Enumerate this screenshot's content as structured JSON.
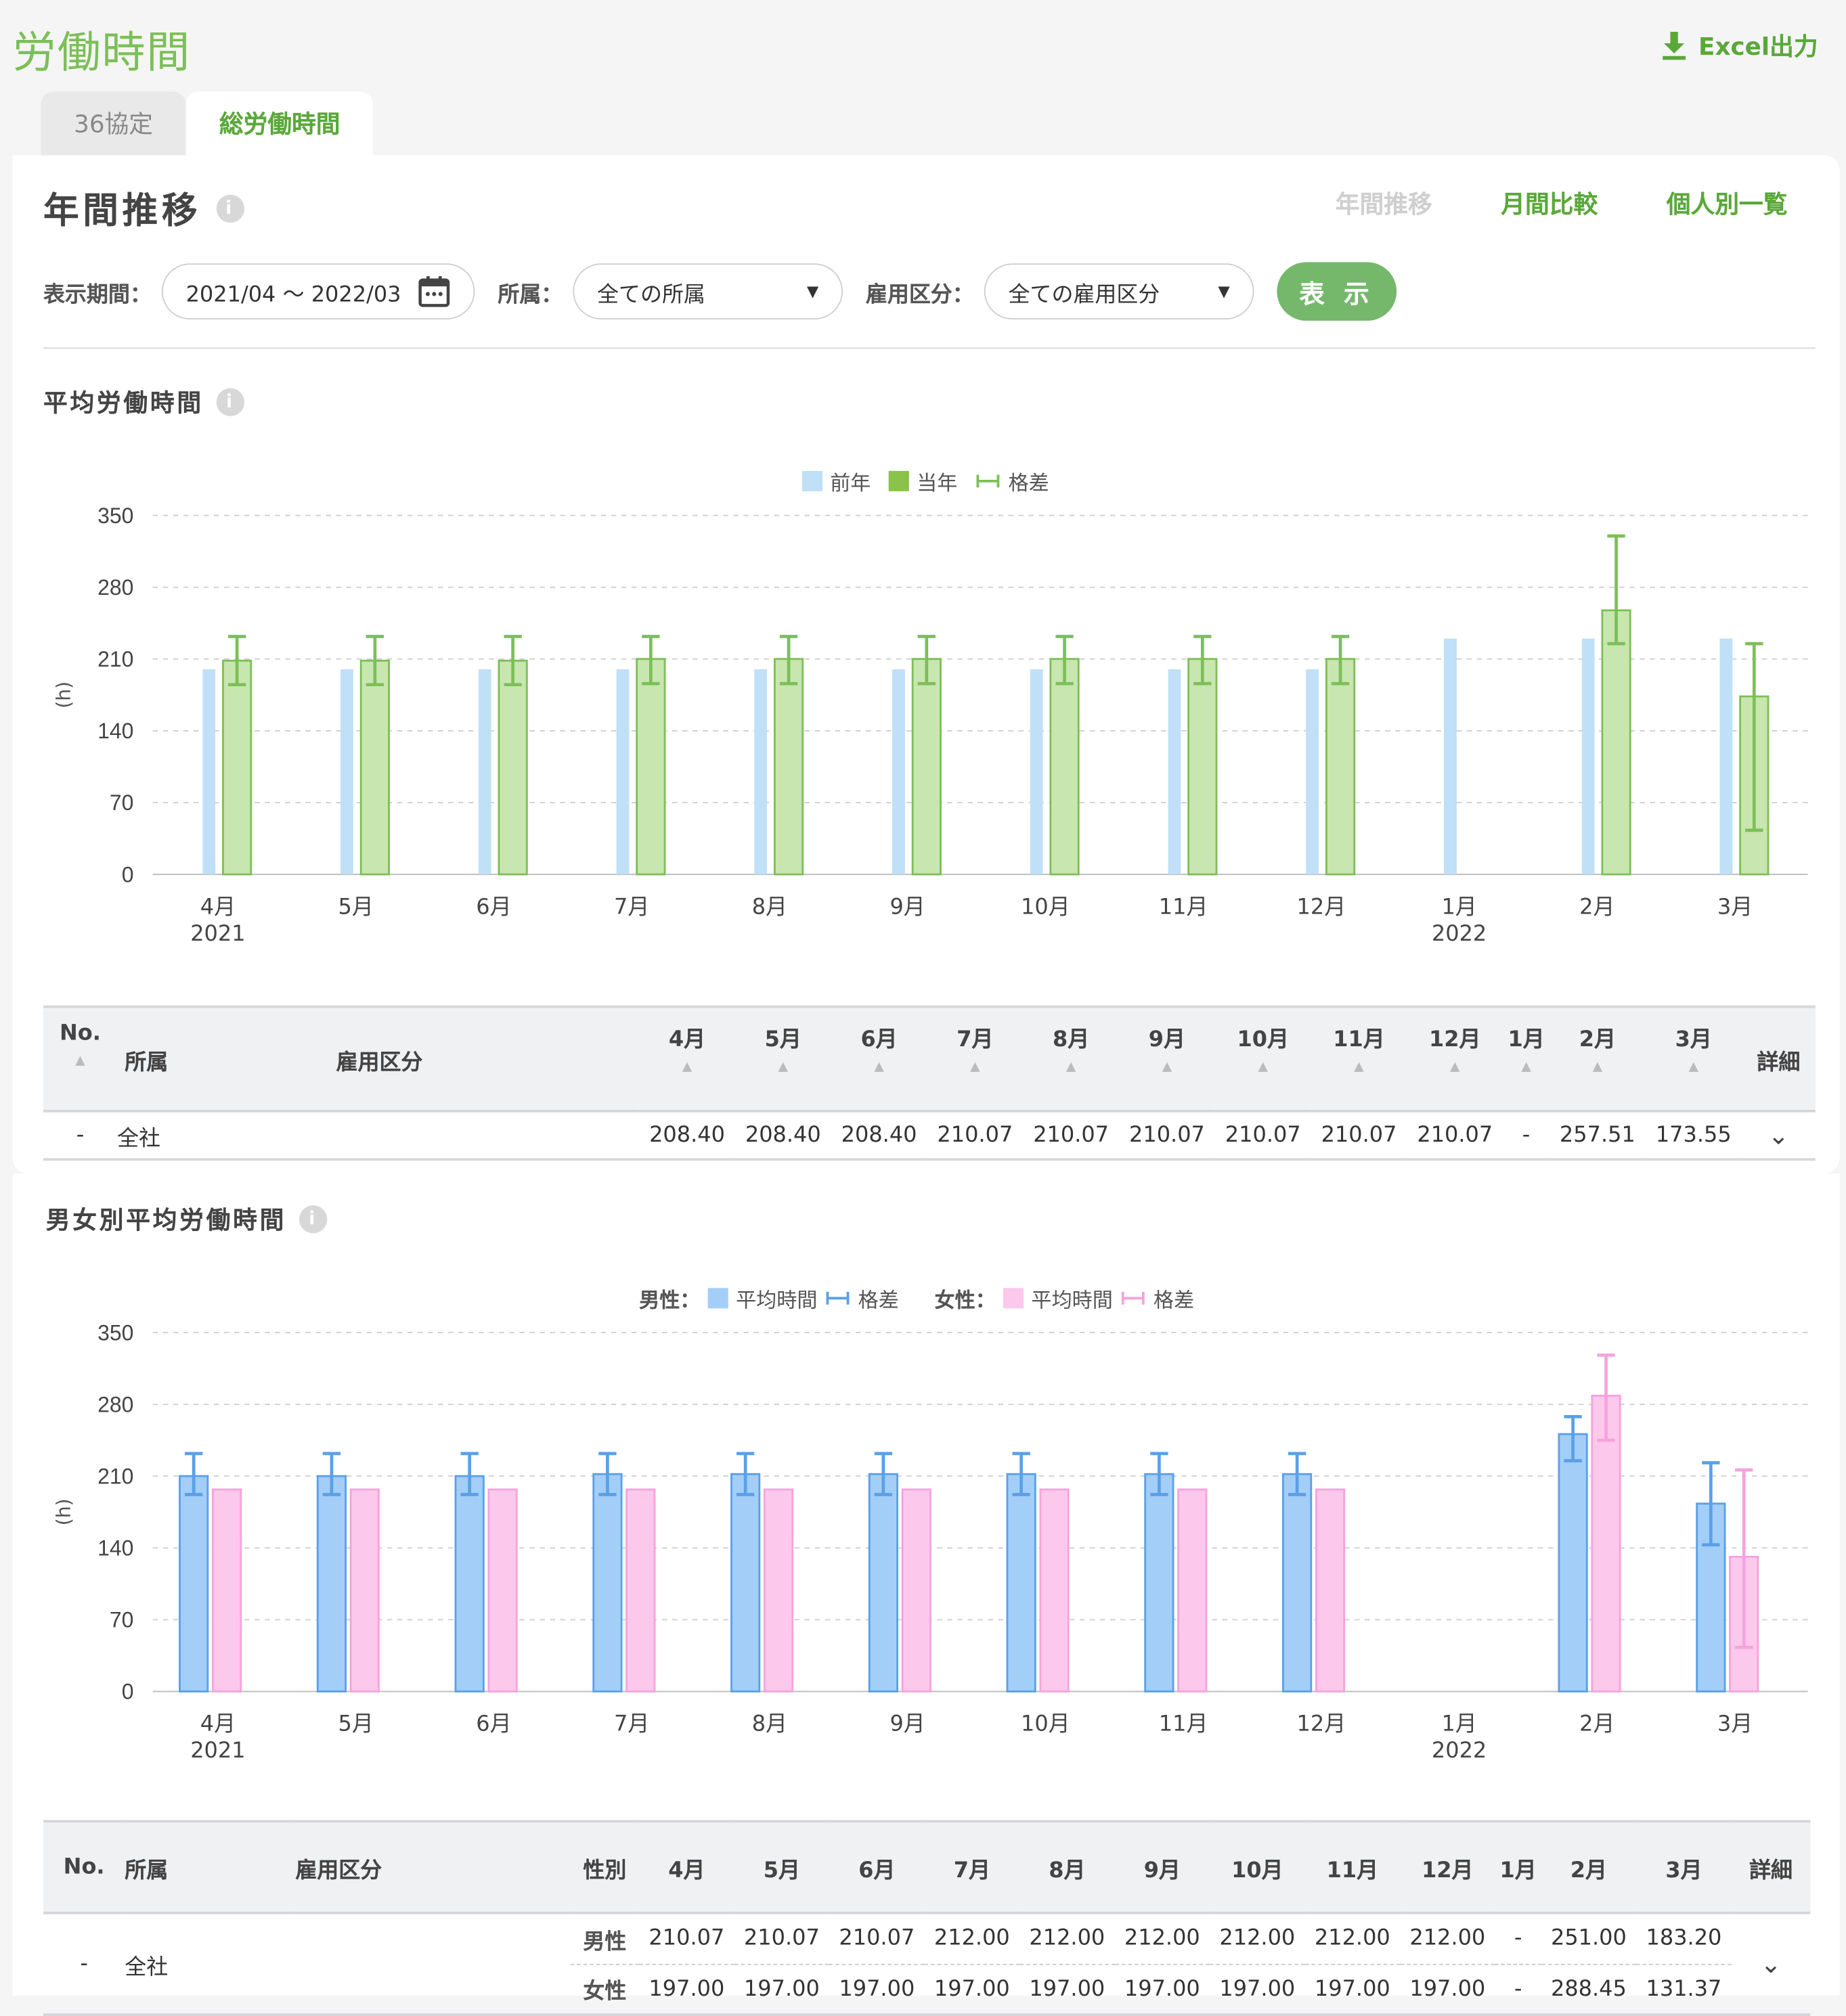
{
  "header": {
    "title": "労働時間",
    "excel_label": "Excel出力"
  },
  "tabs": [
    {
      "label": "36協定"
    },
    {
      "label": "総労働時間"
    }
  ],
  "section": {
    "title": "年間推移",
    "views": [
      "年間推移",
      "月間比較",
      "個人別一覧"
    ]
  },
  "filters": {
    "period_label": "表示期間：",
    "period_value": "2021/04 ～ 2022/03",
    "dept_label": "所属：",
    "dept_value": "全ての所属",
    "emp_label": "雇用区分：",
    "emp_value": "全ての雇用区分",
    "show_label": "表 示"
  },
  "chart1_title": "平均労働時間",
  "chart2_title": "男女別平均労働時間",
  "chart_data": [
    {
      "type": "bar",
      "title": "平均労働時間",
      "ylabel": "(h)",
      "ylim": [
        0,
        350
      ],
      "yticks": [
        0,
        70,
        140,
        210,
        280,
        350
      ],
      "categories": [
        "4月",
        "5月",
        "6月",
        "7月",
        "8月",
        "9月",
        "10月",
        "11月",
        "12月",
        "1月",
        "2月",
        "3月"
      ],
      "year_labels": {
        "0": "2021",
        "9": "2022"
      },
      "legend": [
        "前年",
        "当年",
        "格差"
      ],
      "series": [
        {
          "name": "前年",
          "values": [
            200,
            200,
            200,
            200,
            200,
            200,
            200,
            200,
            200,
            230,
            230,
            230
          ]
        },
        {
          "name": "当年",
          "values": [
            208.4,
            208.4,
            208.4,
            210.07,
            210.07,
            210.07,
            210.07,
            210.07,
            210.07,
            null,
            257.51,
            173.55
          ]
        }
      ],
      "error_bars": [
        {
          "low": 185,
          "high": 232
        },
        {
          "low": 185,
          "high": 232
        },
        {
          "low": 185,
          "high": 232
        },
        {
          "low": 186,
          "high": 232
        },
        {
          "low": 186,
          "high": 232
        },
        {
          "low": 186,
          "high": 232
        },
        {
          "low": 186,
          "high": 232
        },
        {
          "low": 186,
          "high": 232
        },
        {
          "low": 186,
          "high": 232
        },
        null,
        {
          "low": 225,
          "high": 330
        },
        {
          "low": 43,
          "high": 225
        }
      ],
      "colors": {
        "prev": "#bfe0f6",
        "curr": "#c8e6b0",
        "curr_border": "#7cbf57",
        "err": "#7cbf57"
      }
    },
    {
      "type": "bar",
      "title": "男女別平均労働時間",
      "ylabel": "(h)",
      "ylim": [
        0,
        350
      ],
      "yticks": [
        0,
        70,
        140,
        210,
        280,
        350
      ],
      "categories": [
        "4月",
        "5月",
        "6月",
        "7月",
        "8月",
        "9月",
        "10月",
        "11月",
        "12月",
        "1月",
        "2月",
        "3月"
      ],
      "year_labels": {
        "0": "2021",
        "9": "2022"
      },
      "legend": {
        "male_prefix": "男性：",
        "female_prefix": "女性：",
        "avg": "平均時間",
        "gap": "格差"
      },
      "series": [
        {
          "name": "男性",
          "values": [
            210.07,
            210.07,
            210.07,
            212.0,
            212.0,
            212.0,
            212.0,
            212.0,
            212.0,
            null,
            251.0,
            183.2
          ]
        },
        {
          "name": "女性",
          "values": [
            197.0,
            197.0,
            197.0,
            197.0,
            197.0,
            197.0,
            197.0,
            197.0,
            197.0,
            null,
            288.45,
            131.37
          ]
        }
      ],
      "male_err": [
        {
          "low": 192,
          "high": 232
        },
        {
          "low": 192,
          "high": 232
        },
        {
          "low": 192,
          "high": 232
        },
        {
          "low": 192,
          "high": 232
        },
        {
          "low": 192,
          "high": 232
        },
        {
          "low": 192,
          "high": 232
        },
        {
          "low": 192,
          "high": 232
        },
        {
          "low": 192,
          "high": 232
        },
        {
          "low": 192,
          "high": 232
        },
        null,
        {
          "low": 225,
          "high": 268
        },
        {
          "low": 143,
          "high": 223
        }
      ],
      "female_err": [
        null,
        null,
        null,
        null,
        null,
        null,
        null,
        null,
        null,
        null,
        {
          "low": 245,
          "high": 328
        },
        {
          "low": 43,
          "high": 216
        }
      ],
      "colors": {
        "male": "#a3cef7",
        "male_border": "#5aa0e8",
        "female": "#fcc8ec",
        "female_border": "#f5a3dc"
      }
    }
  ],
  "table1": {
    "headers": {
      "no": "No.",
      "dept": "所属",
      "emp": "雇用区分",
      "detail": "詳細"
    },
    "months": [
      "4月",
      "5月",
      "6月",
      "7月",
      "8月",
      "9月",
      "10月",
      "11月",
      "12月",
      "1月",
      "2月",
      "3月"
    ],
    "row": {
      "no": "-",
      "dept": "全社",
      "values": [
        "208.40",
        "208.40",
        "208.40",
        "210.07",
        "210.07",
        "210.07",
        "210.07",
        "210.07",
        "210.07",
        "-",
        "257.51",
        "173.55"
      ]
    }
  },
  "table2": {
    "headers": {
      "no": "No.",
      "dept": "所属",
      "emp": "雇用区分",
      "sex": "性別",
      "detail": "詳細"
    },
    "months": [
      "4月",
      "5月",
      "6月",
      "7月",
      "8月",
      "9月",
      "10月",
      "11月",
      "12月",
      "1月",
      "2月",
      "3月"
    ],
    "row": {
      "no": "-",
      "dept": "全社",
      "male": {
        "label": "男性",
        "values": [
          "210.07",
          "210.07",
          "210.07",
          "212.00",
          "212.00",
          "212.00",
          "212.00",
          "212.00",
          "212.00",
          "-",
          "251.00",
          "183.20"
        ]
      },
      "female": {
        "label": "女性",
        "values": [
          "197.00",
          "197.00",
          "197.00",
          "197.00",
          "197.00",
          "197.00",
          "197.00",
          "197.00",
          "197.00",
          "-",
          "288.45",
          "131.37"
        ]
      }
    }
  }
}
